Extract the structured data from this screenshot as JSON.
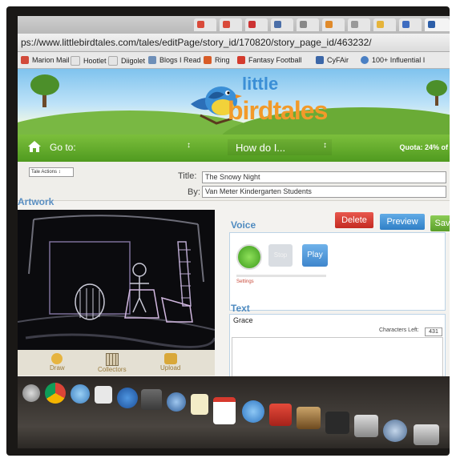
{
  "browser": {
    "url": "ps://www.littlebirdtales.com/tales/editPage/story_id/170820/story_page_id/463232/",
    "bookmarks": [
      {
        "label": "Marion Mail",
        "color": "#d24a3a"
      },
      {
        "label": "Hootlet",
        "color": "#cfcfcf"
      },
      {
        "label": "Diigolet",
        "color": "#cfcfcf"
      },
      {
        "label": "Blogs I Read",
        "color": "#6e8fb8"
      },
      {
        "label": "Ring",
        "color": "#d85c28"
      },
      {
        "label": "Fantasy Football",
        "color": "#d43b2d"
      },
      {
        "label": "CyFAir",
        "color": "#3c67a8"
      },
      {
        "label": "100+ Influential I",
        "color": "#4a80c4"
      }
    ]
  },
  "site": {
    "logo_line1": "little",
    "logo_line2": "birdtales",
    "nav": {
      "goto_label": "Go to:",
      "howdo_label": "How do I...",
      "quota": "Quota: 24% of"
    }
  },
  "editor": {
    "tale_actions": "Tale Actions",
    "title_label": "Title:",
    "title_value": "The Snowy Night",
    "by_label": "By:",
    "by_value": "Van Meter Kindergarten Students",
    "artwork_heading": "Artwork",
    "art_tools": [
      "Draw",
      "Collectors",
      "Upload"
    ],
    "buttons": {
      "delete": "Delete",
      "preview": "Preview",
      "save": "Sav"
    },
    "voice": {
      "heading": "Voice",
      "stop": "Stop",
      "play": "Play",
      "settings": "Settings"
    },
    "text": {
      "heading": "Text",
      "content": "Grace",
      "chars_left_label": "Characters Left:",
      "chars_left_value": "431"
    }
  },
  "colors": {
    "nav_green": "#5ea52a",
    "delete_red": "#d9372e",
    "preview_blue": "#3f8fd4",
    "save_green": "#6fb53a",
    "heading_blue": "#4f8bc0"
  }
}
